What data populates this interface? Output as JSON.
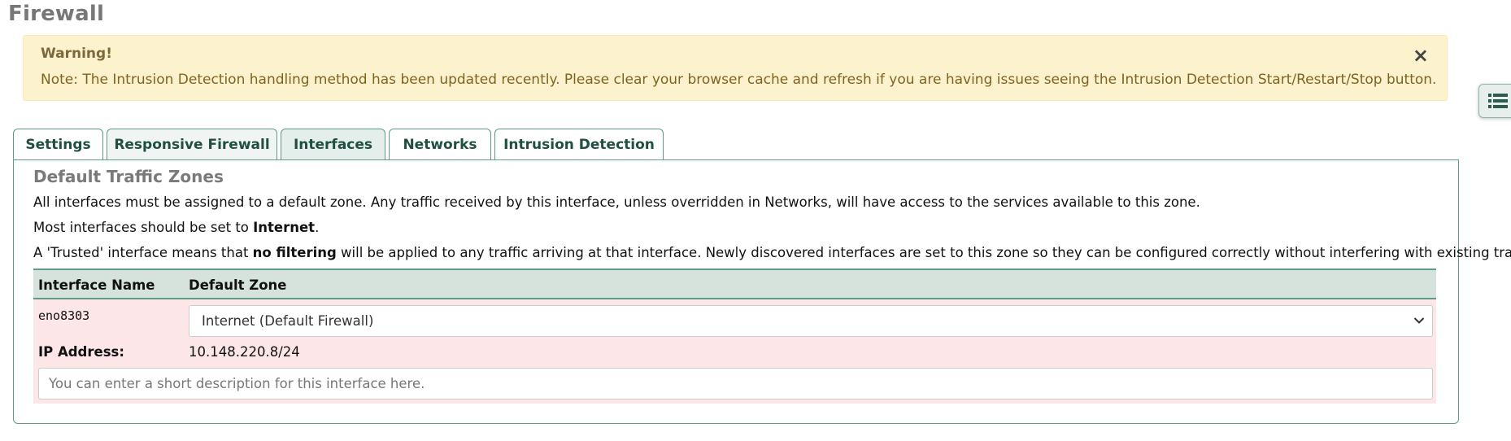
{
  "page": {
    "title": "Firewall"
  },
  "alert": {
    "title": "Warning!",
    "text": "Note: The Intrusion Detection handling method has been updated recently. Please clear your browser cache and refresh if you are having issues seeing the Intrusion Detection Start/Restart/Stop button.",
    "close_label": "×"
  },
  "side_toggle": {
    "icon": "list-icon"
  },
  "tabs": [
    {
      "label": "Settings",
      "active": false
    },
    {
      "label": "Responsive Firewall",
      "active": false
    },
    {
      "label": "Interfaces",
      "active": true
    },
    {
      "label": "Networks",
      "active": false
    },
    {
      "label": "Intrusion Detection",
      "active": false
    }
  ],
  "panel": {
    "title": "Default Traffic Zones",
    "p1": "All interfaces must be assigned to a default zone. Any traffic received by this interface, unless overridden in Networks, will have access to the services available to this zone.",
    "p2_pre": "Most interfaces should be set to ",
    "p2_bold": "Internet",
    "p2_post": ".",
    "p3_pre": "A 'Trusted' interface means that ",
    "p3_bold": "no filtering",
    "p3_post": " will be applied to any traffic arriving at that interface. Newly discovered interfaces are set to this zone so they can be configured correctly without interfering with existing traffic.",
    "table": {
      "headers": {
        "name": "Interface Name",
        "zone": "Default Zone"
      },
      "row": {
        "interface": "eno8303",
        "zone": "Internet (Default Firewall)",
        "ip_label": "IP Address:",
        "ip_value": "10.148.220.8/24",
        "description_value": "",
        "description_placeholder": "You can enter a short description for this interface here."
      }
    }
  },
  "colors": {
    "accent": "#5f9c88",
    "tab_text": "#1f4f43",
    "alert_bg": "#fcf2cd",
    "row_bg": "#fde6e8",
    "header_bg": "#d5e3dc"
  }
}
